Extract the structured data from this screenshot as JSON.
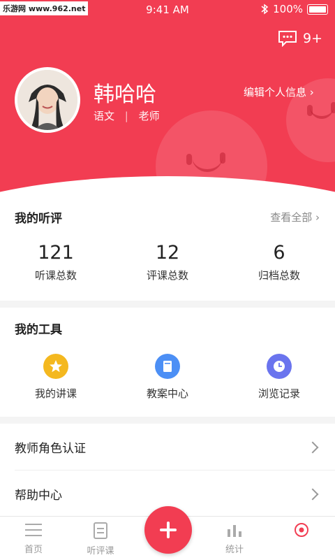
{
  "status_bar": {
    "time": "9:41 AM",
    "battery": "100%"
  },
  "watermark": "乐游网 www.962.net",
  "header": {
    "message_count": "9+",
    "name": "韩哈哈",
    "subject": "语文",
    "role": "老师",
    "separator": "|",
    "edit_label": "编辑个人信息 ›"
  },
  "evaluations": {
    "title": "我的听评",
    "view_all": "查看全部 ›",
    "stats": [
      {
        "value": "121",
        "label": "听课总数"
      },
      {
        "value": "12",
        "label": "评课总数"
      },
      {
        "value": "6",
        "label": "归档总数"
      }
    ]
  },
  "tools": {
    "title": "我的工具",
    "items": [
      {
        "label": "我的讲课",
        "icon": "star-icon",
        "color": "#f4b81f"
      },
      {
        "label": "教案中心",
        "icon": "book-icon",
        "color": "#4c8ff5"
      },
      {
        "label": "浏览记录",
        "icon": "clock-icon",
        "color": "#6a74ee"
      }
    ]
  },
  "menu": [
    {
      "label": "教师角色认证"
    },
    {
      "label": "帮助中心"
    }
  ],
  "tabbar": {
    "items": [
      {
        "label": "首页"
      },
      {
        "label": "听评课"
      },
      {
        "label": "统计"
      },
      {
        "label": ""
      }
    ]
  },
  "colors": {
    "accent": "#f23d52"
  }
}
